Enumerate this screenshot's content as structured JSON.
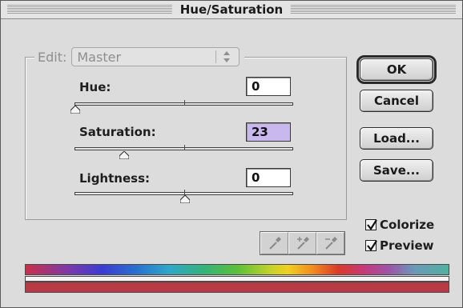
{
  "window": {
    "title": "Hue/Saturation"
  },
  "edit": {
    "label": "Edit:",
    "value": "Master",
    "arrow_icon": "up-down-arrows-icon"
  },
  "hue": {
    "label": "Hue:",
    "value": "0",
    "slider_position_fraction": 0.0
  },
  "saturation": {
    "label": "Saturation:",
    "value": "23",
    "slider_position_fraction": 0.23
  },
  "lightness": {
    "label": "Lightness:",
    "value": "0",
    "slider_position_fraction": 0.5
  },
  "buttons": {
    "ok": "OK",
    "cancel": "Cancel",
    "load": "Load...",
    "save": "Save..."
  },
  "checkboxes": {
    "colorize": {
      "label": "Colorize",
      "checked": true
    },
    "preview": {
      "label": "Preview",
      "checked": true
    }
  },
  "eyedroppers": [
    "eyedropper-icon",
    "eyedropper-plus-icon",
    "eyedropper-minus-icon"
  ],
  "colors": {
    "selected_field": "#c9b8ee",
    "colorize_result": "#b83a44"
  }
}
